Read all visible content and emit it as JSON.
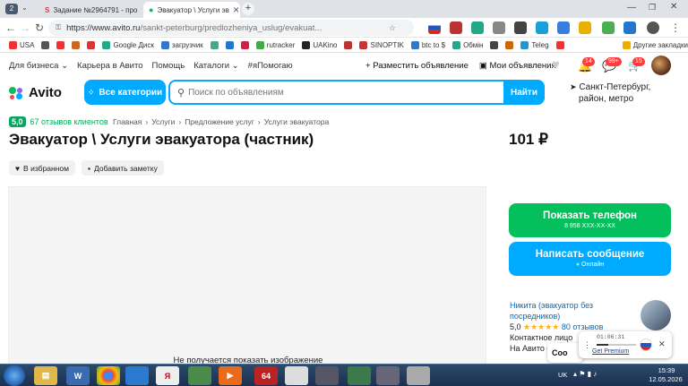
{
  "browser": {
    "tab_counter": "2",
    "tabs": [
      {
        "label": "Задание №2964791 - про"
      },
      {
        "label": "Эвакуатор \\ Услуги эв"
      }
    ],
    "url_host": "https://www.avito.ru",
    "url_path": "/sankt-peterburg/predlozheniya_uslug/evakuat..."
  },
  "bookmarks": [
    {
      "label": "USA",
      "color": "#e33"
    },
    {
      "label": "",
      "color": "#555"
    },
    {
      "label": "",
      "color": "#e33"
    },
    {
      "label": "",
      "color": "#c62"
    },
    {
      "label": "",
      "color": "#d33"
    },
    {
      "label": "Google Диск",
      "color": "#2a8"
    },
    {
      "label": "загрузчик",
      "color": "#37c"
    },
    {
      "label": "",
      "color": "#4a8"
    },
    {
      "label": "",
      "color": "#27c"
    },
    {
      "label": "",
      "color": "#c24"
    },
    {
      "label": "rutracker",
      "color": "#4a4"
    },
    {
      "label": "UAKino",
      "color": "#222"
    },
    {
      "label": "",
      "color": "#b33"
    },
    {
      "label": "SINOPTIK",
      "color": "#c33"
    },
    {
      "label": "btc to $",
      "color": "#37c"
    },
    {
      "label": "Обмін",
      "color": "#2a8"
    },
    {
      "label": "",
      "color": "#444"
    },
    {
      "label": "",
      "color": "#c60"
    },
    {
      "label": "Teleg",
      "color": "#29c"
    },
    {
      "label": "",
      "color": "#e33"
    },
    {
      "label": "Другие закладки",
      "color": "#e9b000"
    }
  ],
  "topnav": {
    "business": "Для бизнеса",
    "career": "Карьера в Авито",
    "help": "Помощь",
    "catalogs": "Каталоги",
    "hashtag": "#яПомогаю",
    "post_ad": "Разместить объявление",
    "my_ads": "Мои объявления",
    "badge_notifications": "14",
    "badge_messages": "99+",
    "badge_cart": "15"
  },
  "header": {
    "logo": "Avito",
    "categories_button": "Все категории",
    "search_placeholder": "Поиск по объявлениям",
    "search_button": "Найти",
    "location_line1": "Санкт-Петербург,",
    "location_line2": "район, метро"
  },
  "listing": {
    "rating": "5,0",
    "reviews": "67 отзывов клиентов",
    "breadcrumbs": [
      "Главная",
      "Услуги",
      "Предложение услуг",
      "Услуги эвакуатора"
    ],
    "title": "Эвакуатор \\ Услуги эвакуатора (частник)",
    "price": "101 ₽",
    "favorite_button": "В избранном",
    "note_button": "Добавить заметку",
    "no_image_text": "Не получается показать изображение"
  },
  "sidebar": {
    "phone_button": "Показать телефон",
    "phone_number": "8 958 XXX-XX-XX",
    "message_button": "Написать сообщение",
    "online_status": "Онлайн",
    "seller_name_line1": "Никита (эвакуатор без",
    "seller_name_line2": "посредников)",
    "seller_rating": "5,0",
    "seller_stars": "★★★★★",
    "seller_reviews": "80 отзывов",
    "contact_person": "Контактное лицо",
    "on_avito": "На Авито с",
    "partial_word": "Соо"
  },
  "popup": {
    "timer": "01:06:31",
    "premium": "Get Premium"
  },
  "taskbar": {
    "lang": "UK",
    "time": "15:39",
    "date": "12.05.2026"
  },
  "colors": {
    "avito_blue": "#00aaff",
    "avito_green": "#04c05c",
    "rating_green": "#04a75b"
  }
}
